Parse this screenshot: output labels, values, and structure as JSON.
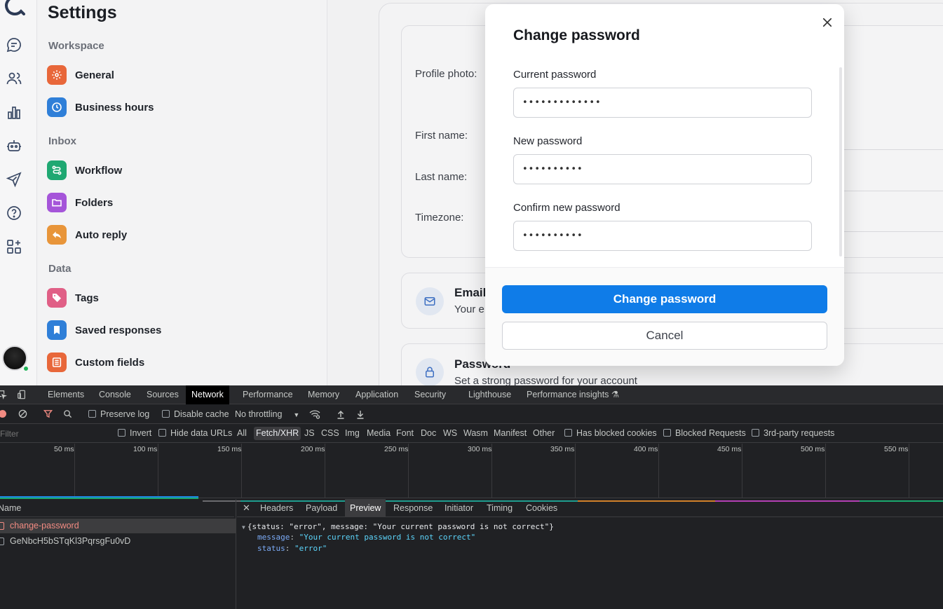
{
  "settings": {
    "title": "Settings",
    "sections": [
      {
        "label": "Workspace",
        "items": [
          {
            "label": "General",
            "icon": "gear-icon",
            "color": "#e8673a"
          },
          {
            "label": "Business hours",
            "icon": "clock-icon",
            "color": "#2f7fd8"
          }
        ]
      },
      {
        "label": "Inbox",
        "items": [
          {
            "label": "Workflow",
            "icon": "workflow-icon",
            "color": "#1fa872"
          },
          {
            "label": "Folders",
            "icon": "folder-icon",
            "color": "#a555d9"
          },
          {
            "label": "Auto reply",
            "icon": "reply-icon",
            "color": "#e8953a"
          }
        ]
      },
      {
        "label": "Data",
        "items": [
          {
            "label": "Tags",
            "icon": "tag-icon",
            "color": "#e05f86"
          },
          {
            "label": "Saved responses",
            "icon": "bookmark-icon",
            "color": "#2f7fd8"
          },
          {
            "label": "Custom fields",
            "icon": "list-icon",
            "color": "#e8673a"
          }
        ]
      }
    ]
  },
  "profile": {
    "profile_photo_label": "Profile photo:",
    "first_name_label": "First name:",
    "last_name_label": "Last name:",
    "timezone_label": "Timezone:",
    "email_title": "Email",
    "email_sub": "Your e",
    "password_title": "Password",
    "password_sub": "Set a strong password for your account"
  },
  "modal": {
    "title": "Change password",
    "current_label": "Current password",
    "current_value": "•••••••••••••",
    "new_label": "New password",
    "new_value": "••••••••••",
    "confirm_label": "Confirm new password",
    "confirm_value": "••••••••••",
    "submit_label": "Change password",
    "cancel_label": "Cancel"
  },
  "devtools": {
    "tabs": [
      "Elements",
      "Console",
      "Sources",
      "Network",
      "Performance",
      "Memory",
      "Application",
      "Security",
      "Lighthouse",
      "Performance insights ⚗"
    ],
    "active_tab": "Network",
    "toolbar": {
      "preserve_log": "Preserve log",
      "disable_cache": "Disable cache",
      "throttling": "No throttling"
    },
    "filter": {
      "placeholder": "Filter",
      "invert": "Invert",
      "hide_data_urls": "Hide data URLs",
      "types": [
        "All",
        "Fetch/XHR",
        "JS",
        "CSS",
        "Img",
        "Media",
        "Font",
        "Doc",
        "WS",
        "Wasm",
        "Manifest",
        "Other"
      ],
      "active_type": "Fetch/XHR",
      "has_blocked_cookies": "Has blocked cookies",
      "blocked_requests": "Blocked Requests",
      "third_party": "3rd-party requests"
    },
    "timeline_ticks": [
      "50 ms",
      "100 ms",
      "150 ms",
      "200 ms",
      "250 ms",
      "300 ms",
      "350 ms",
      "400 ms",
      "450 ms",
      "500 ms",
      "550 ms"
    ],
    "name_header": "Name",
    "requests": [
      {
        "name": "change-password",
        "failed": true
      },
      {
        "name": "GeNbcH5bSTqKl3PqrsgFu0vD",
        "failed": false
      }
    ],
    "detail_tabs": [
      "Headers",
      "Payload",
      "Preview",
      "Response",
      "Initiator",
      "Timing",
      "Cookies"
    ],
    "active_detail_tab": "Preview",
    "preview": {
      "summary": "{status: \"error\", message: \"Your current password is not correct\"}",
      "message_key": "message",
      "message_value": "\"Your current password is not correct\"",
      "status_key": "status",
      "status_value": "\"error\""
    }
  }
}
